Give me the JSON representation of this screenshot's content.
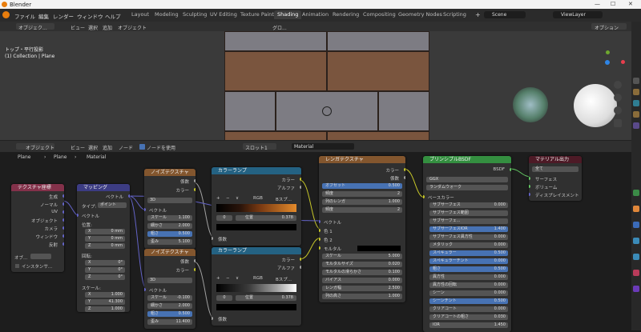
{
  "titlebar": {
    "app": "Blender",
    "minimize": "—",
    "maximize": "☐",
    "close": "✕"
  },
  "menu": [
    "ファイル",
    "編集",
    "レンダー",
    "ウィンドウ",
    "ヘルプ"
  ],
  "workspaces": [
    "Layout",
    "Modeling",
    "Sculpting",
    "UV Editing",
    "Texture Paint",
    "Shading",
    "Animation",
    "Rendering",
    "Compositing",
    "Geometry Nodes",
    "Scripting"
  ],
  "workspace_add": "+",
  "scene": {
    "label": "Scene",
    "viewlayer": "ViewLayer"
  },
  "viewport": {
    "mode": "オブジェク...",
    "view": "ビュー",
    "select": "選択",
    "add": "追加",
    "object": "オブジェクト",
    "transform": "グロ...",
    "options": "オプション",
    "overlay_title": "トップ・平行投影",
    "overlay_collection": "(1) Collection | Plane"
  },
  "node_header": {
    "mode": "オブジェクト",
    "view": "ビュー",
    "select": "選択",
    "add": "追加",
    "node": "ノード",
    "use_nodes": "ノードを使用",
    "slot": "スロット1",
    "material": "Material"
  },
  "breadcrumb": [
    "Plane",
    "Plane",
    "Material"
  ],
  "node_texcoord": {
    "title": "テクスチャ座標",
    "outputs": [
      "生成",
      "ノーマル",
      "UV",
      "オブジェクト",
      "カメラ",
      "ウィンドウ",
      "反射"
    ],
    "obj_label": "オブ...",
    "instancer": "インスタンサ..."
  },
  "node_mapping": {
    "title": "マッピング",
    "out": "ベクトル",
    "type_label": "タイプ:",
    "type_value": "ポイント",
    "in_vector": "ベクトル",
    "location": "位置:",
    "rotation": "回転:",
    "scale": "スケール:",
    "loc": [
      [
        "X",
        "0 mm"
      ],
      [
        "Y",
        "0 mm"
      ],
      [
        "Z",
        "0 mm"
      ]
    ],
    "rot": [
      [
        "X",
        "0°"
      ],
      [
        "Y",
        "0°"
      ],
      [
        "Z",
        "0°"
      ]
    ],
    "scl": [
      [
        "X",
        "1.000"
      ],
      [
        "Y",
        "41.300"
      ],
      [
        "Z",
        "1.000"
      ]
    ]
  },
  "node_noise1": {
    "title": "ノイズテクスチャ",
    "outputs": [
      "係数",
      "カラー"
    ],
    "dim": "3D",
    "in_vector": "ベクトル",
    "fields": [
      [
        "スケール",
        "1.100"
      ],
      [
        "細かさ",
        "2.000"
      ],
      [
        "粗さ",
        "0.500"
      ],
      [
        "歪み",
        "5.100"
      ]
    ]
  },
  "node_noise2": {
    "title": "ノイズテクスチャ",
    "outputs": [
      "係数",
      "カラー"
    ],
    "dim": "3D",
    "in_vector": "ベクトル",
    "fields": [
      [
        "スケール",
        "-0.100"
      ],
      [
        "細かさ",
        "2.000"
      ],
      [
        "粗さ",
        "0.500"
      ],
      [
        "歪み",
        "11.400"
      ]
    ]
  },
  "node_ramp1": {
    "title": "カラーランプ",
    "outputs": [
      "カラー",
      "アルファ"
    ],
    "mode": "RGB",
    "interp": "Bスプ...",
    "index": "0",
    "pos_label": "位置",
    "pos_value": "0.378",
    "in": "係数",
    "plus": "+",
    "minus": "−",
    "menu": "∨"
  },
  "node_ramp2": {
    "title": "カラーランプ",
    "outputs": [
      "カラー",
      "アルファ"
    ],
    "mode": "RGB",
    "interp": "Bスプ...",
    "index": "0",
    "pos_label": "位置",
    "pos_value": "0.378",
    "in": "係数",
    "plus": "+",
    "minus": "−",
    "menu": "∨"
  },
  "node_brick": {
    "title": "レンガテクスチャ",
    "outputs": [
      "カラー",
      "係数"
    ],
    "fields1": [
      [
        "オフセット",
        "0.500"
      ],
      [
        "頻度",
        "2"
      ],
      [
        "列のレンガ",
        "1.000"
      ],
      [
        "頻度",
        "2"
      ]
    ],
    "inputs": [
      "ベクトル",
      "色 1",
      "色 2",
      "モルタル"
    ],
    "fields2": [
      [
        "スケール",
        "5.000"
      ],
      [
        "モルタルサイズ",
        "0.020"
      ],
      [
        "モルタルの滑らかさ",
        "0.100"
      ],
      [
        "バイアス",
        "0.000"
      ],
      [
        "レンガ幅",
        "2.500"
      ],
      [
        "列の高さ",
        "1.000"
      ]
    ]
  },
  "node_bsdf": {
    "title": "プリンシプルBSDF",
    "output": "BSDF",
    "dist": "GGX",
    "sss": "ランダムウォーク",
    "base": "ベースカラー",
    "rows": [
      [
        "サブサーフェス",
        "0.000"
      ],
      [
        "サブサーフェス範囲",
        ""
      ],
      [
        "サブサーフェ...",
        ""
      ],
      [
        "サブサーフェスIOR",
        "1.400"
      ],
      [
        "サブサーフェス異方性",
        "0.000"
      ],
      [
        "メタリック",
        "0.000"
      ],
      [
        "スペキュラー",
        "0.500"
      ],
      [
        "スペキュラーチント",
        "0.000"
      ],
      [
        "粗さ",
        "0.500"
      ],
      [
        "異方性",
        "0.000"
      ],
      [
        "異方性の回転",
        "0.000"
      ],
      [
        "シーン",
        "0.000"
      ],
      [
        "シーンチント",
        "0.500"
      ],
      [
        "クリアコート",
        "0.000"
      ],
      [
        "クリアコートの粗さ",
        "0.030"
      ],
      [
        "IOR",
        "1.450"
      ]
    ]
  },
  "node_output": {
    "title": "マテリアル出力",
    "target": "全て",
    "inputs": [
      "サーフェス",
      "ボリューム",
      "ディスプレイスメント"
    ]
  },
  "colors": {
    "input_header": "#83314a",
    "vector_header": "#3c3c83",
    "texture_header": "#83562e",
    "converter_header": "#246283",
    "shader_header": "#348f40",
    "output_header": "#4d1a26",
    "socket_yellow": "#c7c729",
    "socket_gray": "#a1a1a1",
    "socket_green": "#63c763",
    "socket_blue": "#6363c7"
  }
}
